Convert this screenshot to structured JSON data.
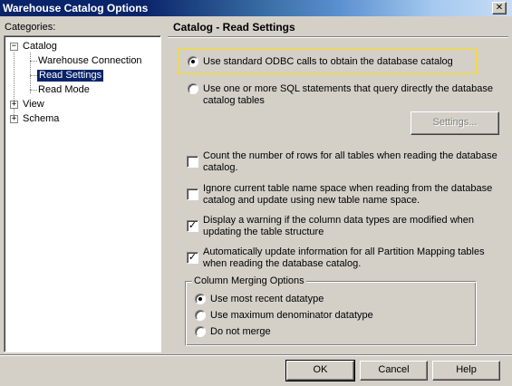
{
  "window": {
    "title": "Warehouse Catalog Options",
    "close_glyph": "✕"
  },
  "categories": {
    "label": "Categories:",
    "tree": [
      {
        "label": "Catalog",
        "expander": "−"
      },
      {
        "label": "Warehouse Connection"
      },
      {
        "label": "Read Settings",
        "selected": true
      },
      {
        "label": "Read Mode"
      },
      {
        "label": "View",
        "expander": "+"
      },
      {
        "label": "Schema",
        "expander": "+"
      }
    ]
  },
  "panel": {
    "title": "Catalog - Read Settings",
    "radio_options": [
      {
        "label": "Use standard ODBC calls to obtain the database catalog",
        "checked": true
      },
      {
        "label_line1": "Use one or more SQL statements that query directly the database",
        "label_line2": "catalog tables",
        "checked": false
      }
    ],
    "settings_button": "Settings...",
    "checkboxes": [
      {
        "line1": "Count the number of rows for all tables when reading the database",
        "line2": "catalog.",
        "checked": false
      },
      {
        "line1": "Ignore current table name space when reading from the database",
        "line2": "catalog and update using new table name space.",
        "checked": false
      },
      {
        "line1": "Display a warning if the column data types are modified when",
        "line2": "updating the table structure",
        "checked": true
      },
      {
        "line1": "Automatically update information for all Partition Mapping tables",
        "line2": "when reading the database catalog.",
        "checked": true
      }
    ],
    "column_merging": {
      "legend": "Column Merging Options",
      "options": [
        {
          "label": "Use most recent datatype",
          "checked": true
        },
        {
          "label": "Use maximum denominator datatype",
          "checked": false
        },
        {
          "label": "Do not merge",
          "checked": false
        }
      ]
    }
  },
  "footer": {
    "ok": "OK",
    "cancel": "Cancel",
    "help": "Help"
  },
  "colors": {
    "titlebar_start": "#0a246a",
    "face": "#d4d0c8",
    "selection": "#0a246a",
    "focus": "#ffe000"
  },
  "icons": {
    "check": "✓"
  }
}
